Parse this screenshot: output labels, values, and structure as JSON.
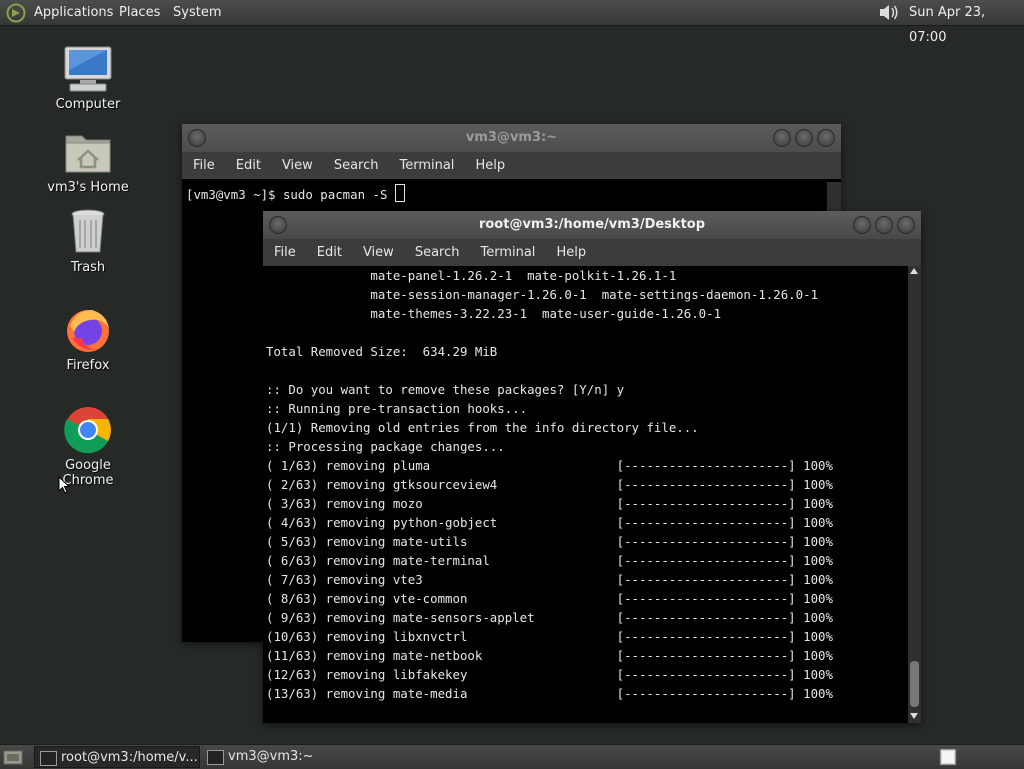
{
  "top_panel": {
    "menu_applications": "Applications",
    "menu_places": "Places",
    "menu_system": "System",
    "clock": "Sun Apr 23, 07:00",
    "volume_icon": "speaker-icon"
  },
  "desktop_icons": {
    "computer": "Computer",
    "home": "vm3's Home",
    "trash": "Trash",
    "firefox": "Firefox",
    "chrome": "Google Chrome"
  },
  "back_terminal": {
    "title": "vm3@vm3:~",
    "menu": [
      "File",
      "Edit",
      "View",
      "Search",
      "Terminal",
      "Help"
    ],
    "prompt": "[vm3@vm3 ~]$ sudo pacman -S "
  },
  "front_terminal": {
    "title": "root@vm3:/home/vm3/Desktop",
    "menu": [
      "File",
      "Edit",
      "View",
      "Search",
      "Terminal",
      "Help"
    ],
    "lines": [
      "              mate-panel-1.26.2-1  mate-polkit-1.26.1-1",
      "              mate-session-manager-1.26.0-1  mate-settings-daemon-1.26.0-1",
      "              mate-themes-3.22.23-1  mate-user-guide-1.26.0-1",
      "",
      "Total Removed Size:  634.29 MiB",
      "",
      ":: Do you want to remove these packages? [Y/n] y",
      ":: Running pre-transaction hooks...",
      "(1/1) Removing old entries from the info directory file...",
      ":: Processing package changes...",
      "( 1/63) removing pluma                         [----------------------] 100%",
      "( 2/63) removing gtksourceview4                [----------------------] 100%",
      "( 3/63) removing mozo                          [----------------------] 100%",
      "( 4/63) removing python-gobject                [----------------------] 100%",
      "( 5/63) removing mate-utils                    [----------------------] 100%",
      "( 6/63) removing mate-terminal                 [----------------------] 100%",
      "( 7/63) removing vte3                          [----------------------] 100%",
      "( 8/63) removing vte-common                    [----------------------] 100%",
      "( 9/63) removing mate-sensors-applet           [----------------------] 100%",
      "(10/63) removing libxnvctrl                    [----------------------] 100%",
      "(11/63) removing mate-netbook                  [----------------------] 100%",
      "(12/63) removing libfakekey                    [----------------------] 100%",
      "(13/63) removing mate-media                    [----------------------] 100%"
    ]
  },
  "taskbar": {
    "task1": "root@vm3:/home/v...",
    "task2": "vm3@vm3:~"
  }
}
